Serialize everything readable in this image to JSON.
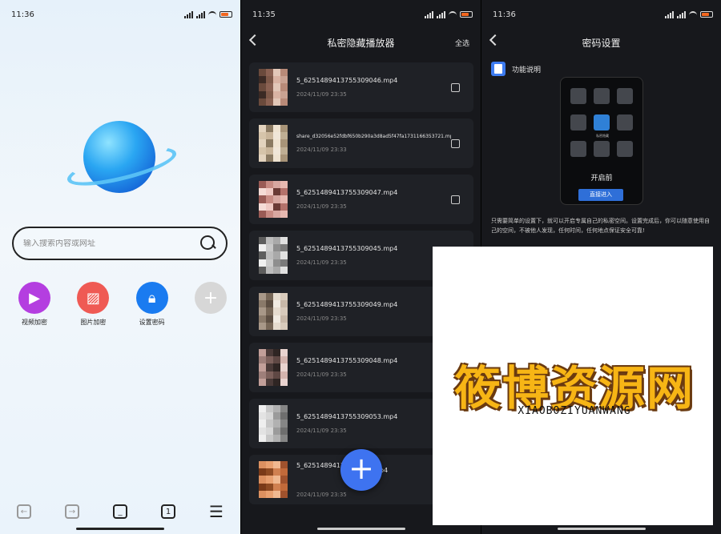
{
  "screen1": {
    "status_time": "11:36",
    "search_placeholder": "输入搜索内容或网址",
    "shortcuts": [
      {
        "label": "视频加密",
        "color": "#b43ee0",
        "icon": "video-icon"
      },
      {
        "label": "图片加密",
        "color": "#ef5a54",
        "icon": "image-icon"
      },
      {
        "label": "设置密码",
        "color": "#1a7bf0",
        "icon": "lock-icon"
      },
      {
        "label": "",
        "color": "#d7d7d7",
        "icon": "plus-icon"
      }
    ],
    "nav_tab_count": "1"
  },
  "screen2": {
    "status_time": "11:35",
    "title": "私密隐藏播放器",
    "select_all": "全选",
    "files": [
      {
        "name": "5_6251489413755309046.mp4",
        "date": "2024/11/09 23:35",
        "small": false,
        "checkbox": true
      },
      {
        "name": "share_d32056e52fdbf650b290a3d8ad5f47fa1731166353721.mp4",
        "date": "2024/11/09 23:33",
        "small": true,
        "checkbox": true
      },
      {
        "name": "5_6251489413755309047.mp4",
        "date": "2024/11/09 23:35",
        "small": false,
        "checkbox": true
      },
      {
        "name": "5_6251489413755309045.mp4",
        "date": "2024/11/09 23:35",
        "small": false,
        "checkbox": false
      },
      {
        "name": "5_6251489413755309049.mp4",
        "date": "2024/11/09 23:35",
        "small": false,
        "checkbox": false
      },
      {
        "name": "5_6251489413755309048.mp4",
        "date": "2024/11/09 23:35",
        "small": false,
        "checkbox": false
      },
      {
        "name": "5_6251489413755309053.mp4",
        "date": "2024/11/09 23:35",
        "small": false,
        "checkbox": false
      },
      {
        "name": "5_62514894137553090",
        "name_tail": "p4",
        "date": "2024/11/09 23:35",
        "small": false,
        "checkbox": false
      }
    ],
    "fab_label": "+"
  },
  "screen3": {
    "status_time": "11:36",
    "title": "密码设置",
    "feature_title": "功能说明",
    "tile_caption": "私密隐藏",
    "before_label": "开启前",
    "enter_button": "直接进入",
    "description": "只需要简单的设置下，就可以开启专属自己的私密空间。设置完成后，你可以随意使用自己的空间，不被他人发现，任何时间，任何地点保证安全可靠!"
  },
  "watermark": {
    "title": "筱博资源网",
    "subtitle": "XIAOBOZIYUANWANG"
  }
}
